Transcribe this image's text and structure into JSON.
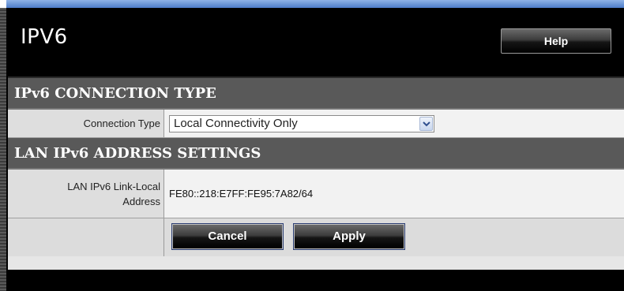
{
  "header": {
    "title": "IPV6",
    "help_label": "Help"
  },
  "connection_section": {
    "heading": "IPv6 CONNECTION TYPE",
    "connection_type_label": "Connection Type",
    "connection_type_value": "Local Connectivity Only"
  },
  "lan_section": {
    "heading": "LAN IPv6 ADDRESS SETTINGS",
    "link_local_label_line1": "LAN IPv6 Link-Local",
    "link_local_label_line2": "Address",
    "link_local_value": "FE80::218:E7FF:FE95:7A82/64"
  },
  "actions": {
    "cancel_label": "Cancel",
    "apply_label": "Apply"
  },
  "colors": {
    "background": "#000000",
    "section_header": "#595959",
    "row_label": "#dedede",
    "row_value": "#f2f2f2",
    "top_strip": "#4d7cc8"
  },
  "icons": {
    "dropdown": "chevron-down-icon"
  }
}
